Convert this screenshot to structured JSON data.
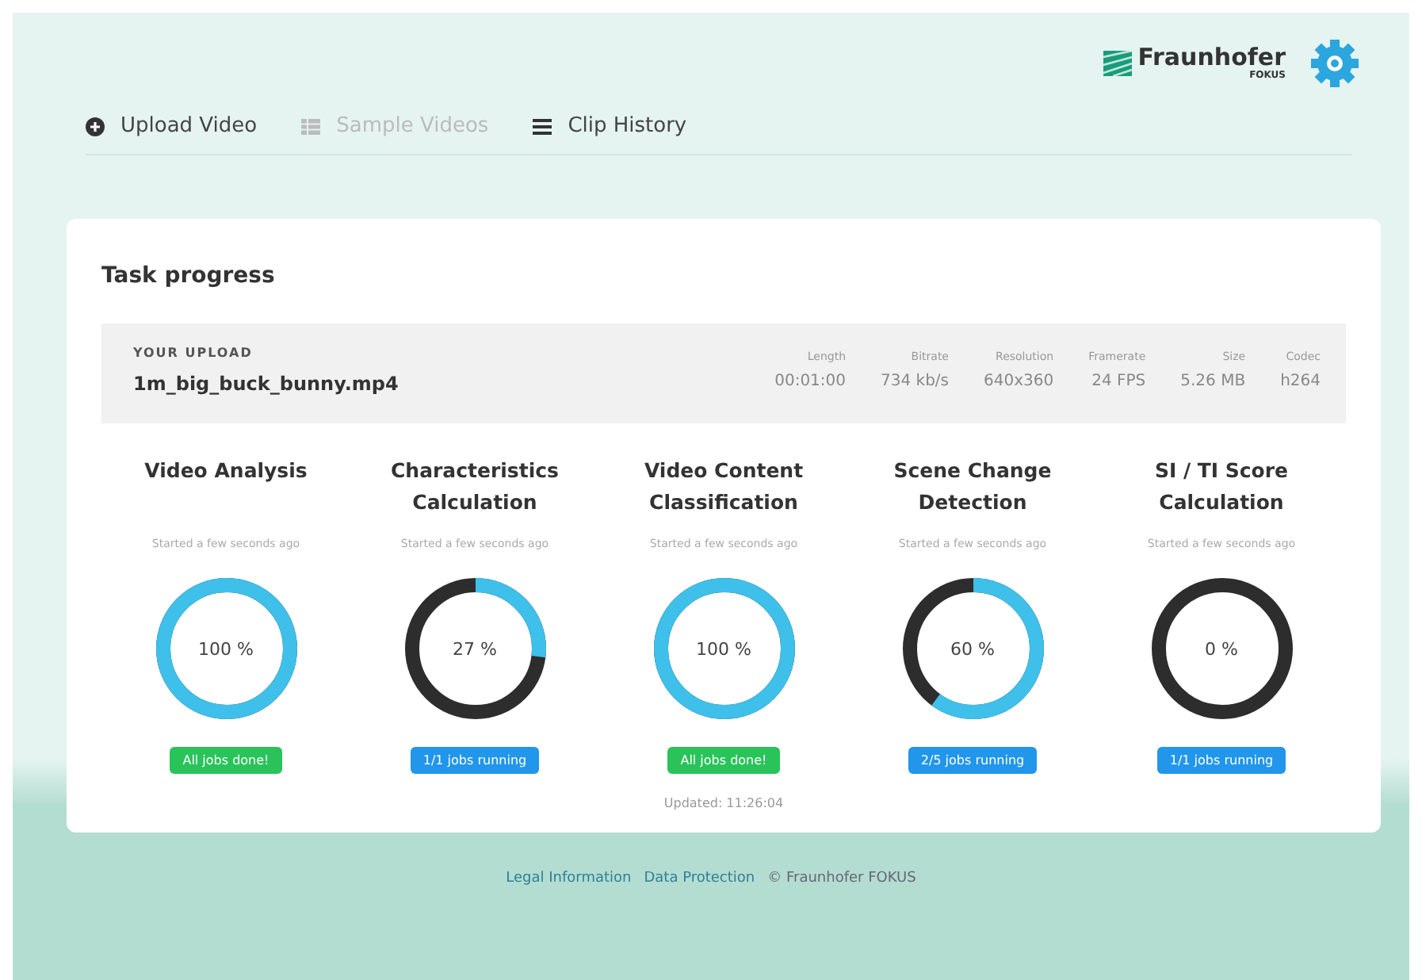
{
  "header": {
    "logo_name": "Fraunhofer",
    "logo_sub": "FOKUS"
  },
  "tabs": [
    {
      "label": "Upload Video",
      "kind": "plus",
      "disabled": false
    },
    {
      "label": "Sample Videos",
      "kind": "grid",
      "disabled": true
    },
    {
      "label": "Clip History",
      "kind": "list",
      "disabled": false
    }
  ],
  "card": {
    "title": "Task progress",
    "upload": {
      "label": "YOUR UPLOAD",
      "filename": "1m_big_buck_bunny.mp4",
      "stats": [
        {
          "label": "Length",
          "value": "00:01:00"
        },
        {
          "label": "Bitrate",
          "value": "734 kb/s"
        },
        {
          "label": "Resolution",
          "value": "640x360"
        },
        {
          "label": "Framerate",
          "value": "24 FPS"
        },
        {
          "label": "Size",
          "value": "5.26 MB"
        },
        {
          "label": "Codec",
          "value": "h264"
        }
      ]
    },
    "tasks": [
      {
        "title": "Video Analysis",
        "started": "Started a few seconds ago",
        "level": 1,
        "percent": "100 %",
        "status": "All jobs done!",
        "kind": "done"
      },
      {
        "title": "Characteristics Calculation",
        "started": "Started a few seconds ago",
        "level": 0.27,
        "percent": "27 %",
        "status": "1/1 jobs running",
        "kind": "running"
      },
      {
        "title": "Video Content Classification",
        "started": "Started a few seconds ago",
        "level": 1,
        "percent": "100 %",
        "status": "All jobs done!",
        "kind": "done",
        "updated": "Updated: 11:26:04"
      },
      {
        "title": "Scene Change Detection",
        "started": "Started a few seconds ago",
        "level": 0.6,
        "percent": "60 %",
        "status": "2/5 jobs running",
        "kind": "running"
      },
      {
        "title": "SI / TI Score Calculation",
        "started": "Started a few seconds ago",
        "level": 0,
        "percent": "0 %",
        "status": "1/1 jobs running",
        "kind": "running"
      }
    ]
  },
  "footer": {
    "links": [
      "Legal Information",
      "Data Protection"
    ],
    "copyright": "© Fraunhofer FOKUS"
  }
}
